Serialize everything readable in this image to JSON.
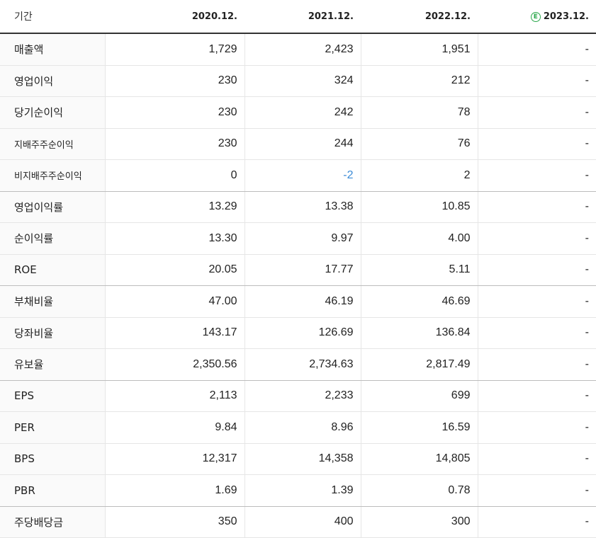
{
  "header": {
    "label": "기간",
    "periods": [
      "2020.12.",
      "2021.12.",
      "2022.12.",
      "2023.12."
    ],
    "estimate_badge": "E",
    "estimate_color": "#2aa74a"
  },
  "rows": [
    {
      "label": "매출액",
      "values": [
        "1,729",
        "2,423",
        "1,951",
        "-"
      ]
    },
    {
      "label": "영업이익",
      "values": [
        "230",
        "324",
        "212",
        "-"
      ]
    },
    {
      "label": "당기순이익",
      "values": [
        "230",
        "242",
        "78",
        "-"
      ]
    },
    {
      "label": "지배주주순이익",
      "values": [
        "230",
        "244",
        "76",
        "-"
      ]
    },
    {
      "label": "비지배주주순이익",
      "values": [
        "0",
        "-2",
        "2",
        "-"
      ]
    },
    {
      "label": "영업이익률",
      "values": [
        "13.29",
        "13.38",
        "10.85",
        "-"
      ]
    },
    {
      "label": "순이익률",
      "values": [
        "13.30",
        "9.97",
        "4.00",
        "-"
      ]
    },
    {
      "label": "ROE",
      "values": [
        "20.05",
        "17.77",
        "5.11",
        "-"
      ]
    },
    {
      "label": "부채비율",
      "values": [
        "47.00",
        "46.19",
        "46.69",
        "-"
      ]
    },
    {
      "label": "당좌비율",
      "values": [
        "143.17",
        "126.69",
        "136.84",
        "-"
      ]
    },
    {
      "label": "유보율",
      "values": [
        "2,350.56",
        "2,734.63",
        "2,817.49",
        "-"
      ]
    },
    {
      "label": "EPS",
      "values": [
        "2,113",
        "2,233",
        "699",
        "-"
      ]
    },
    {
      "label": "PER",
      "values": [
        "9.84",
        "8.96",
        "16.59",
        "-"
      ]
    },
    {
      "label": "BPS",
      "values": [
        "12,317",
        "14,358",
        "14,805",
        "-"
      ]
    },
    {
      "label": "PBR",
      "values": [
        "1.69",
        "1.39",
        "0.78",
        "-"
      ]
    },
    {
      "label": "주당배당금",
      "values": [
        "350",
        "400",
        "300",
        "-"
      ]
    }
  ],
  "negative_color": "#3b8bd6"
}
